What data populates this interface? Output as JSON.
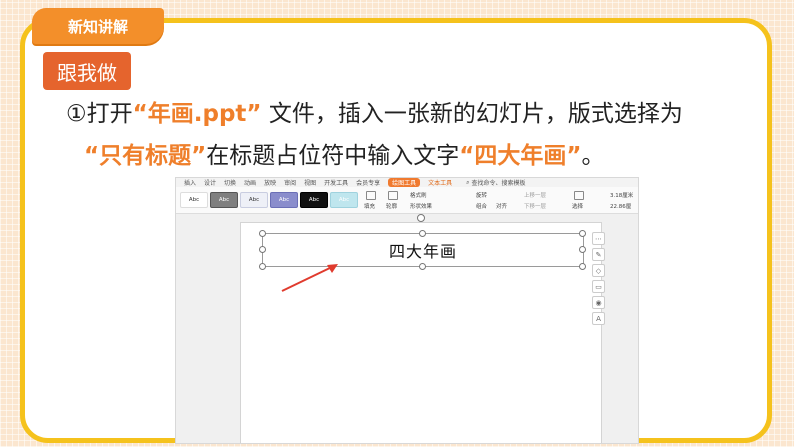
{
  "header": {
    "tag": "新知讲解",
    "badge": "跟我做"
  },
  "instruction": {
    "line1": {
      "a": "①打开",
      "b": "“年画.ppt”",
      "c": " 文件，插入一张新的幻灯片，版式选择为"
    },
    "line2": {
      "a": "“只有标题”",
      "b": "在标题占位符中输入文字",
      "c": "“四大年画”",
      "d": "。"
    }
  },
  "screenshot": {
    "menu": [
      "插入",
      "设计",
      "切换",
      "动画",
      "放映",
      "审阅",
      "视图",
      "开发工具",
      "会员专享"
    ],
    "context_tabs": [
      "绘图工具",
      "文本工具"
    ],
    "search": "查找命令、搜索模板",
    "styles": [
      "Abc",
      "Abc",
      "Abc",
      "Abc",
      "Abc",
      "Abc"
    ],
    "ribbon": {
      "fill": "填充",
      "outline": "轮廓",
      "format_painter": "格式刷",
      "shape_effects": "形状效果",
      "rotate": "旋转",
      "combine": "组合",
      "align": "对齐",
      "bring_forward": "上移一层",
      "send_backward": "下移一层",
      "select": "选择",
      "width": "3.18厘米",
      "height": "22.86厘"
    },
    "slide_title": "四大年画"
  },
  "colors": {
    "accent": "#ef7f2b",
    "border": "#f5c21c",
    "badge": "#e5642d",
    "tag": "#f38f2a"
  }
}
